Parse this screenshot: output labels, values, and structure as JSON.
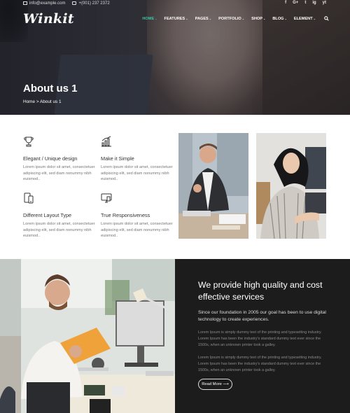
{
  "topbar": {
    "email": "info@example.com",
    "phone": "+(001) 237 2372",
    "social": [
      "f",
      "G+",
      "t",
      "ig",
      "yt"
    ]
  },
  "brand": {
    "logo": "Winkit"
  },
  "nav": {
    "items": [
      {
        "label": "HOME",
        "active": true
      },
      {
        "label": "FEATURES"
      },
      {
        "label": "PAGES"
      },
      {
        "label": "PORTFOLIO"
      },
      {
        "label": "SHOP"
      },
      {
        "label": "BLOG"
      },
      {
        "label": "ELEMENT"
      }
    ],
    "caret": "⌄",
    "search_icon": "search-icon"
  },
  "hero": {
    "title": "About us 1",
    "breadcrumb": "Home > About us 1"
  },
  "features": [
    {
      "icon": "trophy-icon",
      "title": "Elegant / Unique design",
      "text": "Lorem ipsum dolor sit amet, consectetuer adipiscing elit, sed diam nonummy nibh euismod.."
    },
    {
      "icon": "bar-chart-icon",
      "title": "Make it Simple",
      "text": "Lorem ipsum dolor sit amet, consectetuer adipiscing elit, sed diam nonummy nibh euismod.."
    },
    {
      "icon": "mobile-devices-icon",
      "title": "Different Layout Type",
      "text": "Lorem ipsum dolor sit amet, consectetuer adipiscing elit, sed diam nonummy nibh euismod.."
    },
    {
      "icon": "monitor-icon",
      "title": "True Responsiveness",
      "text": "Lorem ipsum dolor sit amet, consectetuer adipiscing elit, sed diam nonummy nibh euismod.."
    }
  ],
  "quality": {
    "title": "We provide high quality and cost effective services",
    "lead": "Since our foundation in 2005 our goal has been to use digital technology to create experiences.",
    "body1": "Lorem Ipsum is simply dummy text of the printing and typesetting industry. Lorem Ipsum has been the industry's standard dummy text ever since the 1500s, when an unknown printer took a galley.",
    "body2": "Lorem Ipsum is simply dummy text of the printing and typesetting industry. Lorem Ipsum has been the industry's standard dummy text ever since the 1500s, when an unknown printer took a galley.",
    "button": "Read More ⟶"
  },
  "colors": {
    "accent": "#3fc4a6",
    "dark_panel": "#1c1c1c"
  }
}
